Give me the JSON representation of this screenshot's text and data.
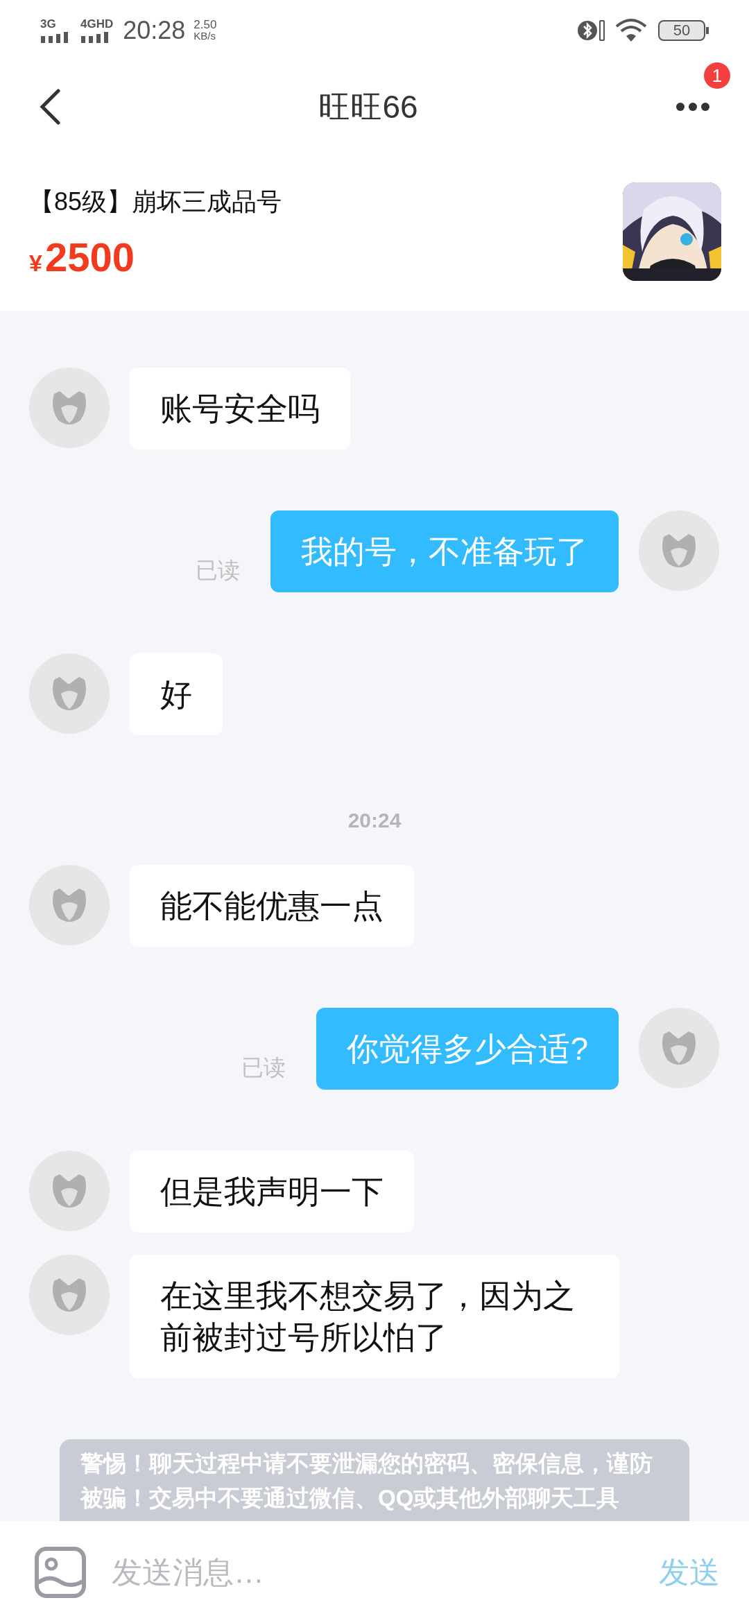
{
  "status_bar": {
    "network_1": "3G",
    "network_2": "4GHD",
    "time": "20:28",
    "speed": "2.50",
    "speed_unit": "KB/s",
    "battery": "50"
  },
  "header": {
    "title": "旺旺66",
    "badge": "1"
  },
  "product": {
    "title": "【85级】崩坏三成品号",
    "currency": "¥",
    "price": "2500"
  },
  "chat": [
    {
      "kind": "incoming",
      "text": "账号安全吗"
    },
    {
      "kind": "outgoing",
      "text": "我的号，不准备玩了",
      "status": "已读"
    },
    {
      "kind": "incoming",
      "text": "好"
    },
    {
      "kind": "time",
      "text": "20:24"
    },
    {
      "kind": "incoming",
      "text": "能不能优惠一点"
    },
    {
      "kind": "outgoing",
      "text": "你觉得多少合适?",
      "status": "已读"
    },
    {
      "kind": "incoming",
      "text": "但是我声明一下"
    },
    {
      "kind": "incoming",
      "text": "在这里我不想交易了，因为之前被封过号所以怕了"
    }
  ],
  "notice": "警惕！聊天过程中请不要泄漏您的密码、密保信息，谨防被骗！交易中不要通过微信、QQ或其他外部聊天工具",
  "composer": {
    "placeholder": "发送消息…",
    "send": "发送"
  }
}
